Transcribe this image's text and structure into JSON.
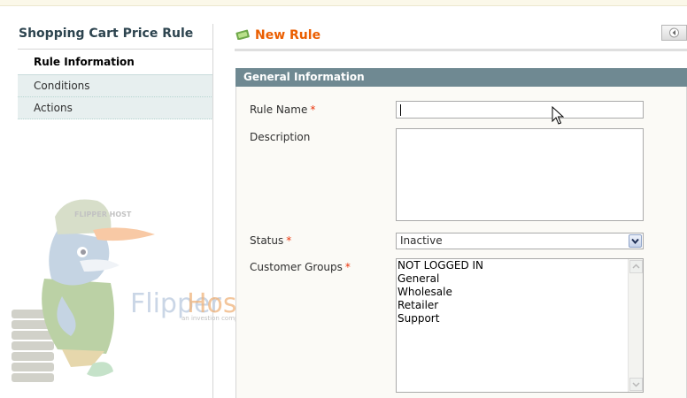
{
  "sidebar": {
    "title": "Shopping Cart Price Rule",
    "items": [
      {
        "label": "Rule Information"
      },
      {
        "label": "Conditions"
      },
      {
        "label": "Actions"
      }
    ]
  },
  "header": {
    "title": "New Rule"
  },
  "section": {
    "title": "General Information"
  },
  "form": {
    "rule_name": {
      "label": "Rule Name",
      "required": "*",
      "value": ""
    },
    "description": {
      "label": "Description",
      "value": ""
    },
    "status": {
      "label": "Status",
      "required": "*",
      "value": "Inactive"
    },
    "customer_groups": {
      "label": "Customer Groups",
      "required": "*",
      "options": [
        "NOT LOGGED IN",
        "General",
        "Wholesale",
        "Retailer",
        "Support"
      ]
    }
  },
  "watermark": {
    "brand_a": "Flipper",
    "brand_b": "Host",
    "tagline": "an investion company",
    "cap_text": "FLIPPER HOST"
  },
  "colors": {
    "accent": "#eb5e00",
    "section_header": "#6f8992",
    "sidebar_bg": "#e7efef",
    "required": "#eb340a"
  }
}
